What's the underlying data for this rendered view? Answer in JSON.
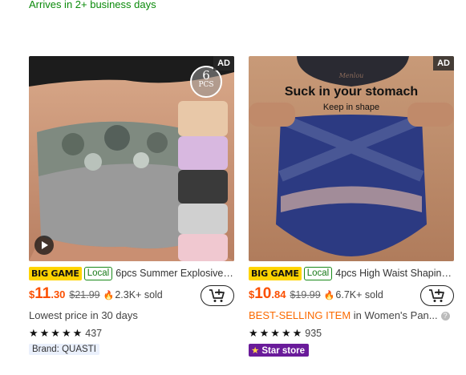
{
  "delivery_note": "Arrives in 2+ business days",
  "products": [
    {
      "ad_label": "AD",
      "tag_big": "BIG GAME",
      "tag_local": "Local",
      "title": "6pcs Summer Explosive ...",
      "currency": "$",
      "price_main": "11",
      "price_cents": ".30",
      "price_original": "$21.99",
      "sold": "2.3K+ sold",
      "line3_text": "Lowest price in 30 days",
      "rating_count": "437",
      "badge": "Brand: QUASTI",
      "image_overlay": {
        "pack_count": "6",
        "pack_unit": "PCS"
      },
      "icons": {
        "sold": "fire-icon",
        "cart": "add-to-cart-icon",
        "play": "play-icon"
      },
      "colors": [
        "#e8c8a8",
        "#d8b8e0",
        "#3a3a3a",
        "#d0d0d0",
        "#f0c8d0"
      ]
    },
    {
      "ad_label": "AD",
      "tag_big": "BIG GAME",
      "tag_local": "Local",
      "title": "4pcs High Waist Shaping ...",
      "currency": "$",
      "price_main": "10",
      "price_cents": ".84",
      "price_original": "$19.99",
      "sold": "6.7K+ sold",
      "line3_highlight": "BEST-SELLING ITEM",
      "line3_rest": " in Women's Pan...",
      "rating_count": "935",
      "badge": "Star store",
      "image_overlay": {
        "headline": "Suck in your stomach",
        "subline": "Keep in shape",
        "brand_mark": "Menlou"
      },
      "icons": {
        "sold": "fire-icon",
        "cart": "add-to-cart-icon",
        "help": "help-icon",
        "store": "star-icon"
      }
    }
  ],
  "accent_price_color": "#fb4f00"
}
